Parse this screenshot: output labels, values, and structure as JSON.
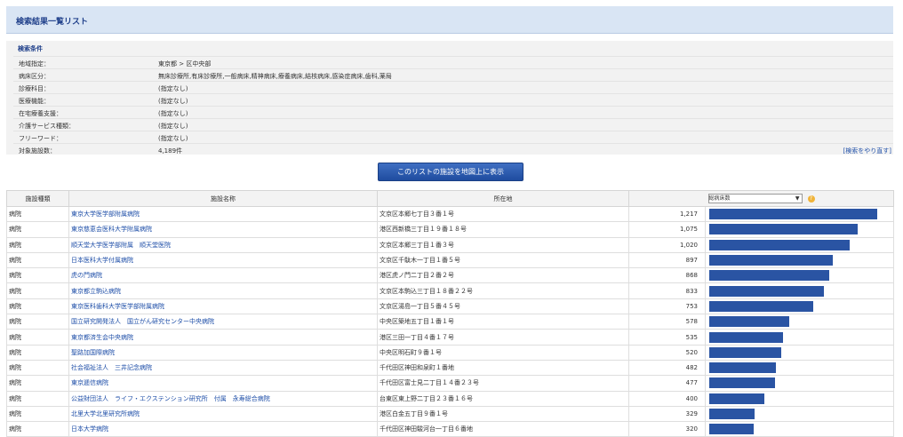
{
  "page_title": "検索結果一覧リスト",
  "conditions": {
    "heading": "検索条件",
    "rows": [
      {
        "label": "地域指定：",
        "value": "東京都 > 区中央部"
      },
      {
        "label": "病床区分：",
        "value": "無床診療所,有床診療所,一般病床,精神病床,療養病床,結核病床,感染症病床,歯科,薬局"
      },
      {
        "label": "診療科目：",
        "value": "(指定なし)"
      },
      {
        "label": "医療機能：",
        "value": "(指定なし)"
      },
      {
        "label": "在宅療養支援：",
        "value": "(指定なし)"
      },
      {
        "label": "介護サービス種類：",
        "value": "(指定なし)"
      },
      {
        "label": "フリーワード：",
        "value": "(指定なし)"
      },
      {
        "label": "対象施設数：",
        "value": "4,189件"
      }
    ],
    "redo_label": "[検索をやり直す]"
  },
  "map_button_label": "このリストの施設を地図上に表示",
  "table": {
    "headers": [
      "施設種類",
      "施設名称",
      "所在地"
    ],
    "sort_select": "総病床数",
    "help_icon": "?",
    "max_value": 1217,
    "rows": [
      {
        "type": "病院",
        "name": "東京大学医学部附属病院",
        "address": "文京区本郷七丁目３番１号",
        "beds": "1,217",
        "beds_num": 1217
      },
      {
        "type": "病院",
        "name": "東京慈恵会医科大学附属病院",
        "address": "港区西新橋三丁目１９番１８号",
        "beds": "1,075",
        "beds_num": 1075
      },
      {
        "type": "病院",
        "name": "順天堂大学医学部附属　順天堂医院",
        "address": "文京区本郷三丁目１番３号",
        "beds": "1,020",
        "beds_num": 1020
      },
      {
        "type": "病院",
        "name": "日本医科大学付属病院",
        "address": "文京区千駄木一丁目１番５号",
        "beds": "897",
        "beds_num": 897
      },
      {
        "type": "病院",
        "name": "虎の門病院",
        "address": "港区虎ノ門二丁目２番２号",
        "beds": "868",
        "beds_num": 868
      },
      {
        "type": "病院",
        "name": "東京都立駒込病院",
        "address": "文京区本駒込三丁目１８番２２号",
        "beds": "833",
        "beds_num": 833
      },
      {
        "type": "病院",
        "name": "東京医科歯科大学医学部附属病院",
        "address": "文京区湯島一丁目５番４５号",
        "beds": "753",
        "beds_num": 753
      },
      {
        "type": "病院",
        "name": "国立研究開発法人　国立がん研究センター中央病院",
        "address": "中央区築地五丁目１番１号",
        "beds": "578",
        "beds_num": 578
      },
      {
        "type": "病院",
        "name": "東京都済生会中央病院",
        "address": "港区三田一丁目４番１７号",
        "beds": "535",
        "beds_num": 535
      },
      {
        "type": "病院",
        "name": "聖路加国際病院",
        "address": "中央区明石町９番１号",
        "beds": "520",
        "beds_num": 520
      },
      {
        "type": "病院",
        "name": "社会福祉法人　三井記念病院",
        "address": "千代田区神田和泉町１番地",
        "beds": "482",
        "beds_num": 482
      },
      {
        "type": "病院",
        "name": "東京逓信病院",
        "address": "千代田区富士見二丁目１４番２３号",
        "beds": "477",
        "beds_num": 477
      },
      {
        "type": "病院",
        "name": "公益財団法人　ライフ・エクステンション研究所　付属　永寿総合病院",
        "address": "台東区東上野二丁目２３番１６号",
        "beds": "400",
        "beds_num": 400
      },
      {
        "type": "病院",
        "name": "北里大学北里研究所病院",
        "address": "港区白金五丁目９番１号",
        "beds": "329",
        "beds_num": 329
      },
      {
        "type": "病院",
        "name": "日本大学病院",
        "address": "千代田区神田駿河台一丁目６番地",
        "beds": "320",
        "beds_num": 320
      }
    ]
  },
  "colors": {
    "bar": "#2a54a3",
    "link": "#1f4fa8",
    "header_bg": "#d9e5f4"
  }
}
